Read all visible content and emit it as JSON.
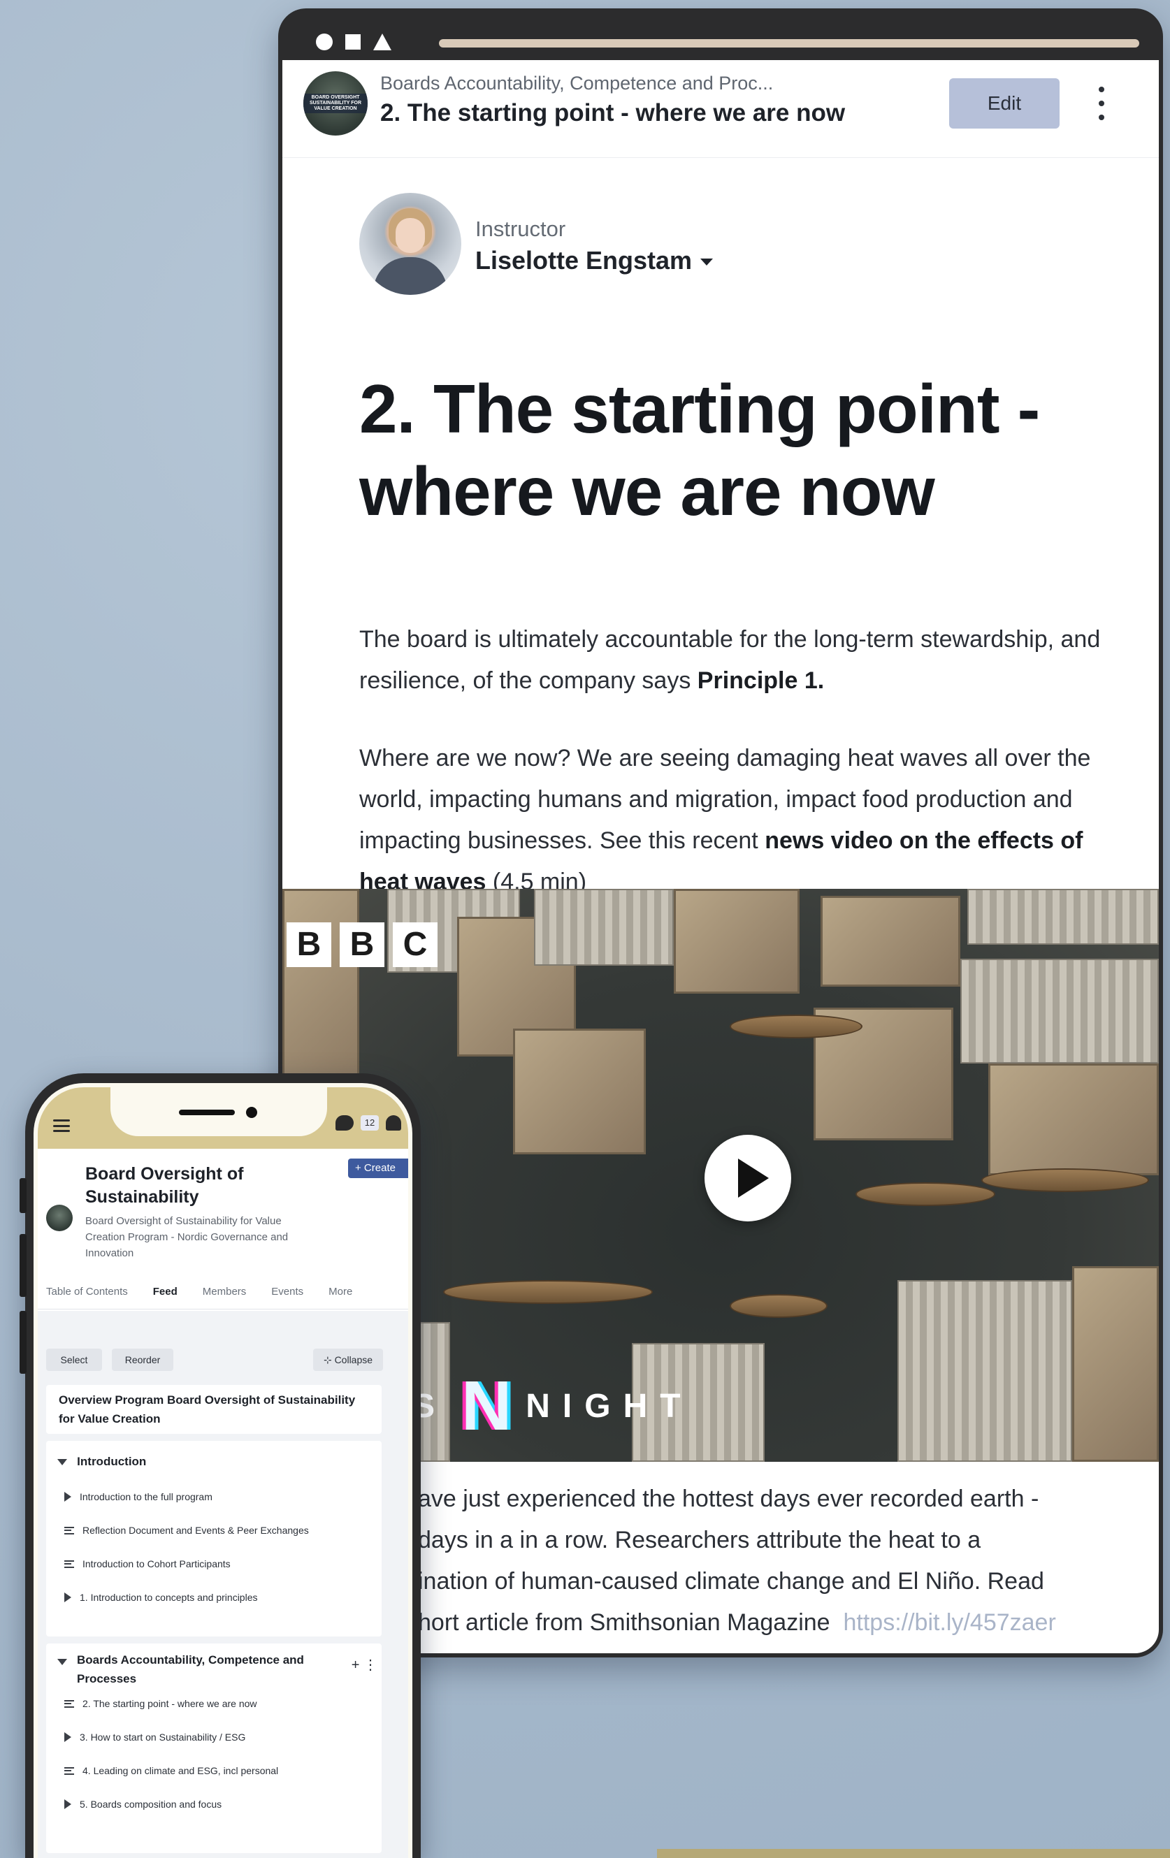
{
  "tablet": {
    "breadcrumb": "Boards Accountability, Competence and Proc...",
    "lesson_title_small": "2. The starting point - where we are now",
    "edit_label": "Edit",
    "course_logo_text": "BOARD OVERSIGHT SUSTAINABILITY FOR VALUE CREATION",
    "instructor_label": "Instructor",
    "instructor_name": "Liselotte Engstam",
    "page_title": "2. The starting point - where we are now",
    "p1_text": "The board is ultimately accountable for the long-term stewardship, and resilience, of the company says ",
    "p1_bold": "Principle 1.",
    "p2_text": "Where are we now? We are seeing damaging heat waves all over the world, impacting humans and migration, impact food production and impacting businesses. See this recent ",
    "p2_bold": "news video on the effects of heat waves",
    "p2_tail": " (4.5 min)",
    "video": {
      "bbc": [
        "B",
        "B",
        "C"
      ],
      "brand_left": "S",
      "brand_right": "NIGHT"
    },
    "p3_lines": [
      "ave just experienced the hottest days ever recorded earth -",
      "days in a  in a row. Researchers attribute the heat to a",
      "ination of human-caused climate change and El Niño. Read"
    ],
    "p3_last": "hort article from Smithsonian Magazine",
    "p3_link": "https://bit.ly/457zaer"
  },
  "phone": {
    "badge_count": "12",
    "create_label": "+ Create",
    "group_title": "Board Oversight of Sustainability",
    "group_subtitle": "Board Oversight of Sustainability for Value Creation Program - Nordic Governance and Innovation",
    "tabs": [
      "Table of Contents",
      "Feed",
      "Members",
      "Events",
      "More"
    ],
    "select_label": "Select",
    "reorder_label": "Reorder",
    "collapse_label": "Collapse",
    "overview": "Overview Program Board Oversight of Sustainability for Value Creation",
    "section1": {
      "title": "Introduction",
      "items": [
        "Introduction to the full program",
        "Reflection Document and Events & Peer Exchanges",
        "Introduction to Cohort Participants",
        "1. Introduction to concepts and principles"
      ]
    },
    "section2": {
      "title": "Boards Accountability, Competence and Processes",
      "items": [
        "2. The starting point - where we are now",
        "3. How to start on Sustainability / ESG",
        "4. Leading on climate and ESG, incl personal",
        "5. Boards composition and focus"
      ]
    }
  }
}
